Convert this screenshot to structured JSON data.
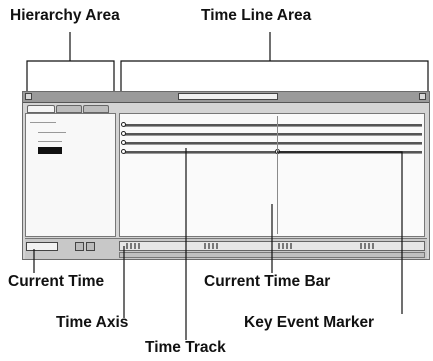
{
  "labels": {
    "hierarchy_area": "Hierarchy Area",
    "time_line_area": "Time Line Area",
    "current_time": "Current Time",
    "current_time_bar": "Current Time Bar",
    "time_axis": "Time Axis",
    "key_event_marker": "Key Event Marker",
    "time_track": "Time Track"
  },
  "colors": {
    "label_text": "#111111",
    "callout_line": "#111111",
    "window_bg": "#d4d4d4",
    "pane_bg": "#fafafa"
  },
  "icons": {
    "tree_root": "tree-root-icon",
    "key_marker": "key-event-marker-icon"
  }
}
